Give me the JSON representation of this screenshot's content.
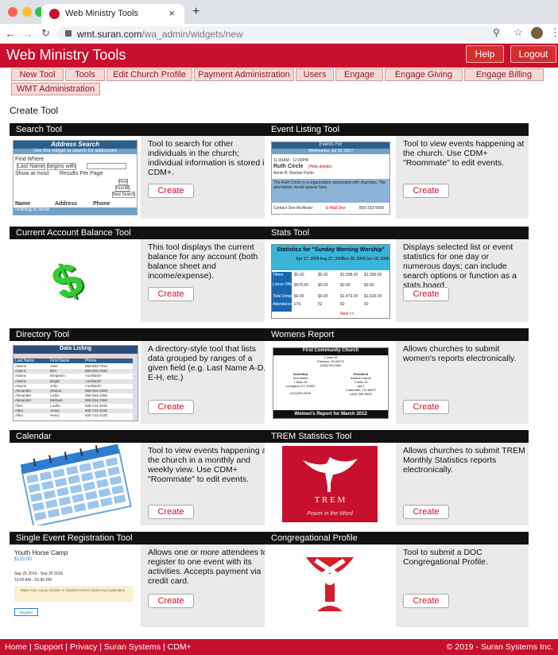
{
  "browser": {
    "tab_title": "Web Ministry Tools",
    "url_host": "wmt.suran.com",
    "url_path": "/wa_admin/widgets/new"
  },
  "header": {
    "title": "Web Ministry Tools",
    "help": "Help",
    "logout": "Logout"
  },
  "nav": {
    "tabs": [
      "New Tool",
      "Tools",
      "Edit Church Profile",
      "Payment Administration",
      "Users",
      "Engage",
      "Engage Giving",
      "Engage Billing",
      "WMT Administration"
    ]
  },
  "page": {
    "heading": "Create Tool"
  },
  "cards": [
    {
      "title": "Search Tool",
      "desc": "Tool to search for other individuals in the church; individual information is stored in CDM+.",
      "button": "Create"
    },
    {
      "title": "Event Listing Tool",
      "desc": "Tool to view events happening at the church. Use CDM+ \"Roommate\" to edit events.",
      "button": "Create"
    },
    {
      "title": "Current Account Balance Tool",
      "desc": "This tool displays the current balance for any account (both balance sheet and income/expense).",
      "button": "Create"
    },
    {
      "title": "Stats Tool",
      "desc": "Displays selected list or event statistics for one day or numerous days; can include search options or function as a stats board.",
      "button": "Create"
    },
    {
      "title": "Directory Tool",
      "desc": "A directory-style tool that lists data grouped by ranges of a given field (e.g. Last Name A-D, E-H, etc.)",
      "button": "Create"
    },
    {
      "title": "Womens Report",
      "desc": "Allows churches to submit women's reports electronically.",
      "button": "Create"
    },
    {
      "title": "Calendar",
      "desc": "Tool to view events happening at the church in a monthly and weekly view. Use CDM+ \"Roommate\" to edit events.",
      "button": "Create"
    },
    {
      "title": "TREM Statistics Tool",
      "desc": "Allows churches to submit TREM Monthly Statistics reports electronically.",
      "button": "Create"
    },
    {
      "title": "Single Event Registration Tool",
      "desc": "Allows one or more attendees to register to one event with its activities. Accepts payment via credit card.",
      "button": "Create"
    },
    {
      "title": "Congregational Profile",
      "desc": "Tool to submit a DOC Congregational Profile.",
      "button": "Create"
    }
  ],
  "thumbs": {
    "search": {
      "title": "Address Search",
      "sub": "Use this widget to search for addresses",
      "find": "Find Where",
      "field": "Last Name",
      "op": "begins with",
      "show": "Show at most",
      "results": "Results Per Page",
      "btn_find": "Find",
      "btn_findall": "Find All",
      "btn_new": "New Search",
      "col_name": "Name",
      "col_addr": "Address",
      "col_phone": "Phone",
      "empty": "Nothing to show"
    },
    "event": {
      "title": "Events For",
      "date": "Wednesday, Jul 18, 2007",
      "time": "11:00AM - 12:00PM",
      "name": "Ruth Circle",
      "link": "(Help details)",
      "sub": "Annie B. Marlow Parlor",
      "desc": "The Ruth Circle is a organization associated with churches. The description would appear here.",
      "contact": "Contact Dee McAlister",
      "email": "E-Mail Dee",
      "phone": "859-333-9999"
    },
    "balance": {
      "symbol": "$"
    },
    "stats": {
      "title": "Statistics for \"Sunday Morning Worship\"",
      "dates": [
        "Apr 27, 2008",
        "Aug 27, 2006",
        "Jun 25, 2006",
        "Jun 18, 2006"
      ],
      "rows": [
        [
          "Tithes",
          "$0.00",
          "$0.00",
          "$1,098.00",
          "$1,300.00"
        ],
        [
          "Loose Offering",
          "$576.00",
          "$0.00",
          "$0.00",
          "$0.00"
        ],
        [
          "Total Detail",
          "$0.00",
          "$0.00",
          "$1,473.00",
          "$1,625.00"
        ],
        [
          "Attendance",
          "276",
          "52",
          "82",
          "92"
        ]
      ],
      "next": "Next >>"
    },
    "directory": {
      "title": "Data Listing",
      "cols": [
        "Last Name",
        "First Name",
        "Phone"
      ],
      "rows": [
        [
          "Adams",
          "Jane",
          "859-663-7533"
        ],
        [
          "Adams",
          "Ben",
          "859-663-7533"
        ],
        [
          "Adams",
          "Benjamin",
          "<unlisted>"
        ],
        [
          "Adams",
          "Brigid",
          "<unlisted>"
        ],
        [
          "Adams",
          "John",
          "<unlisted>"
        ],
        [
          "Alexander",
          "Sharon",
          "859-264-2366"
        ],
        [
          "Alexander",
          "Leslie",
          "859-264-2366"
        ],
        [
          "Alexander",
          "Michael",
          "859-264-2366"
        ],
        [
          "Allen",
          "Lucille",
          "606-723-4030"
        ],
        [
          "Allen",
          "Jesse",
          "606-723-4030"
        ],
        [
          "Allen",
          "Henry",
          "606-723-4030"
        ]
      ]
    },
    "women": {
      "church": "First Community Church",
      "addr1": "1 Main St",
      "addr2": "Elsewon, IN 00073",
      "phone": "(336)733-0382",
      "sec": "Secretary",
      "sec_name": "Test Name",
      "sec_addr": "1 Main St",
      "sec_city": "Lexington, KY 40502",
      "sec_phone": "(111)333-0333",
      "pres": "President",
      "pres_name": "Another Name",
      "pres_addr": "2 Main St",
      "pres_apt": "Apt 1",
      "pres_city": "Cottonville, TN 38017",
      "pres_phone": "(444) 399-6900",
      "footer": "Women's Report for March 2012"
    },
    "trem": {
      "word": "T R E M",
      "motto": "Power in the Word"
    },
    "event_reg": {
      "title": "Youth Horse Camp",
      "price": "$125.00",
      "dates": "Sep 25 2016 - Sep 25 2016",
      "time": "10:00 AM - 01:00 PM",
      "notice": "Make sure popup blocker is disabled before beginning registration.",
      "button": "Register"
    }
  },
  "footer": {
    "links": "Home | Support | Privacy | Suran Systems | CDM+",
    "copyright": "© 2019 - Suran Systems Inc."
  }
}
